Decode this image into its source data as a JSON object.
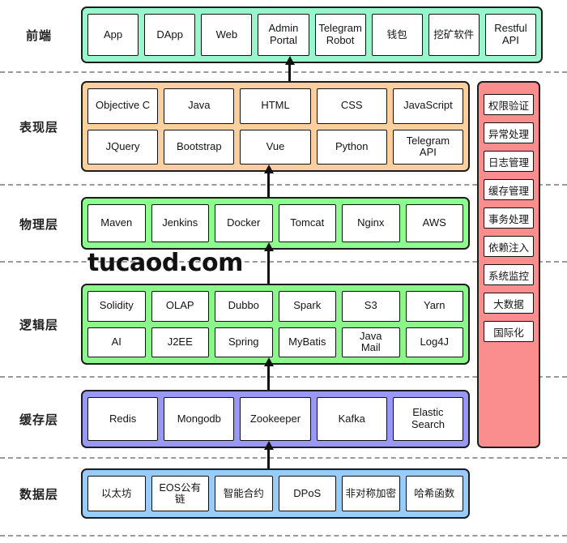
{
  "diagram": {
    "watermark": "tucaod.com",
    "colors": {
      "frontend": "#99f5cc",
      "presentation": "#fccf9e",
      "physical": "#8cff8c",
      "logic": "#8cf58c",
      "cache": "#9999f5",
      "data": "#99ccf9",
      "aspect": "#fa8e8e",
      "chip_background": "#ffffff",
      "border": "#1d1d1d",
      "separator": "#9a9a9a"
    }
  },
  "layers": [
    {
      "label": "前端",
      "color_key": "frontend",
      "rows": [
        [
          {
            "text": "App"
          },
          {
            "text": "DApp"
          },
          {
            "text": "Web"
          },
          {
            "text": "Admin\nPortal"
          },
          {
            "text": "Telegram\nRobot"
          },
          {
            "text": "钱包",
            "cjk": true
          },
          {
            "text": "挖矿软件",
            "cjk": true
          },
          {
            "text": "Restful\nAPI"
          }
        ]
      ]
    },
    {
      "label": "表现层",
      "color_key": "presentation",
      "rows": [
        [
          {
            "text": "Objective C"
          },
          {
            "text": "Java"
          },
          {
            "text": "HTML"
          },
          {
            "text": "CSS"
          },
          {
            "text": "JavaScript"
          }
        ],
        [
          {
            "text": "JQuery"
          },
          {
            "text": "Bootstrap"
          },
          {
            "text": "Vue"
          },
          {
            "text": "Python"
          },
          {
            "text": "Telegram\nAPI"
          }
        ]
      ]
    },
    {
      "label": "物理层",
      "color_key": "physical",
      "rows": [
        [
          {
            "text": "Maven"
          },
          {
            "text": "Jenkins"
          },
          {
            "text": "Docker"
          },
          {
            "text": "Tomcat"
          },
          {
            "text": "Nginx"
          },
          {
            "text": "AWS"
          }
        ]
      ]
    },
    {
      "label": "逻辑层",
      "color_key": "logic",
      "rows": [
        [
          {
            "text": "Solidity"
          },
          {
            "text": "OLAP"
          },
          {
            "text": "Dubbo"
          },
          {
            "text": "Spark"
          },
          {
            "text": "S3"
          },
          {
            "text": "Yarn"
          }
        ],
        [
          {
            "text": "AI"
          },
          {
            "text": "J2EE"
          },
          {
            "text": "Spring"
          },
          {
            "text": "MyBatis"
          },
          {
            "text": "Java\nMail"
          },
          {
            "text": "Log4J"
          }
        ]
      ]
    },
    {
      "label": "缓存层",
      "color_key": "cache",
      "rows": [
        [
          {
            "text": "Redis"
          },
          {
            "text": "Mongodb"
          },
          {
            "text": "Zookeeper"
          },
          {
            "text": "Kafka"
          },
          {
            "text": "Elastic\nSearch"
          }
        ]
      ]
    },
    {
      "label": "数据层",
      "color_key": "data",
      "rows": [
        [
          {
            "text": "以太坊",
            "cjk": true
          },
          {
            "text": "EOS公有链",
            "cjk": true
          },
          {
            "text": "智能合约",
            "cjk": true
          },
          {
            "text": "DPoS"
          },
          {
            "text": "非对称加密",
            "cjk": true
          },
          {
            "text": "哈希函数",
            "cjk": true
          }
        ]
      ]
    }
  ],
  "aspect_column": {
    "items": [
      {
        "text": "权限验证"
      },
      {
        "text": "异常处理"
      },
      {
        "text": "日志管理"
      },
      {
        "text": "缓存管理"
      },
      {
        "text": "事务处理"
      },
      {
        "text": "依赖注入"
      },
      {
        "text": "系统监控"
      },
      {
        "text": "大数据"
      },
      {
        "text": "国际化"
      }
    ]
  }
}
